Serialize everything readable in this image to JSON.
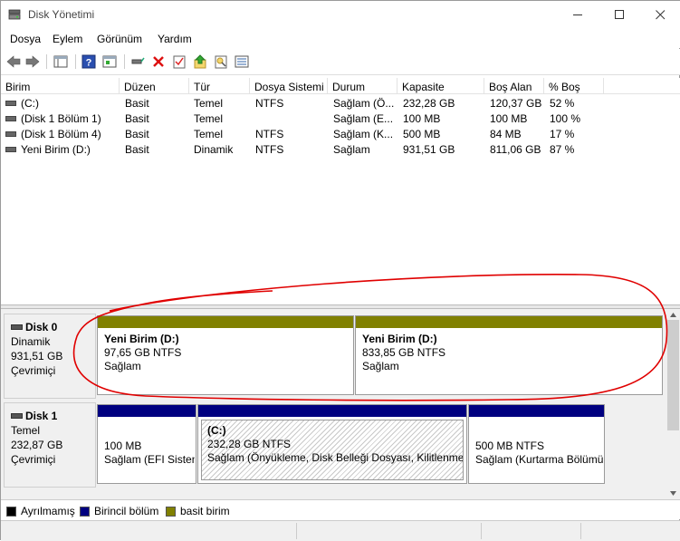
{
  "window": {
    "title": "Disk Yönetimi",
    "minimize": "—",
    "maximize": "☐",
    "close": "✕"
  },
  "menu": [
    "Dosya",
    "Eylem",
    "Görünüm",
    "Yardım"
  ],
  "table": {
    "headers": [
      "Birim",
      "Düzen",
      "Tür",
      "Dosya Sistemi",
      "Durum",
      "Kapasite",
      "Boş Alan",
      "% Boş"
    ],
    "rows": [
      [
        "(C:)",
        "Basit",
        "Temel",
        "NTFS",
        "Sağlam (Ö...",
        "232,28 GB",
        "120,37 GB",
        "52 %"
      ],
      [
        "(Disk 1 Bölüm 1)",
        "Basit",
        "Temel",
        "",
        "Sağlam (E...",
        "100 MB",
        "100 MB",
        "100 %"
      ],
      [
        "(Disk 1 Bölüm 4)",
        "Basit",
        "Temel",
        "NTFS",
        "Sağlam (K...",
        "500 MB",
        "84 MB",
        "17 %"
      ],
      [
        "Yeni Birim (D:)",
        "Basit",
        "Dinamik",
        "NTFS",
        "Sağlam",
        "931,51 GB",
        "811,06 GB",
        "87 %"
      ]
    ]
  },
  "disks": [
    {
      "name": "Disk 0",
      "type": "Dinamik",
      "size": "931,51 GB",
      "state": "Çevrimiçi",
      "partitions": [
        {
          "title": "Yeni Birim  (D:)",
          "size": "97,65 GB NTFS",
          "status": "Sağlam"
        },
        {
          "title": "Yeni Birim  (D:)",
          "size": "833,85 GB NTFS",
          "status": "Sağlam"
        }
      ]
    },
    {
      "name": "Disk 1",
      "type": "Temel",
      "size": "232,87 GB",
      "state": "Çevrimiçi",
      "partitions": [
        {
          "title": "",
          "size": "100 MB",
          "status": "Sağlam (EFI Sisten"
        },
        {
          "title": "(C:)",
          "size": "232,28 GB NTFS",
          "status": "Sağlam (Önyükleme, Disk Belleği Dosyası, Kilitlenme E"
        },
        {
          "title": "",
          "size": "500 MB NTFS",
          "status": "Sağlam (Kurtarma Bölümü"
        }
      ]
    }
  ],
  "legend": [
    {
      "label": "Ayrılmamış",
      "color": "#000000"
    },
    {
      "label": "Birincil bölüm",
      "color": "#000080"
    },
    {
      "label": "basit birim",
      "color": "#808000"
    }
  ],
  "colors": {
    "primary": "#000080",
    "simple": "#808000",
    "annotation": "#e00000"
  },
  "toolbar_icons": [
    "back-icon",
    "forward-icon",
    "console-tree-icon",
    "help-icon",
    "properties-icon",
    "connect-icon",
    "delete-icon",
    "checklist-icon",
    "upload-icon",
    "search-icon",
    "list-icon"
  ]
}
